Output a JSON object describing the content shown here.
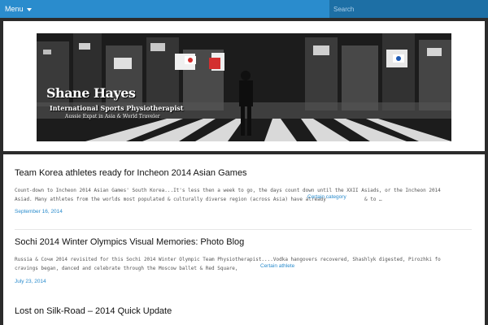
{
  "topbar": {
    "menu_label": "Menu",
    "search_placeholder": "Search",
    "colors": {
      "bar": "#2a8ccd",
      "search_bg": "#1d6fa5"
    }
  },
  "header": {
    "title": "Shane Hayes",
    "subtitle": "International Sports Physiotherapist",
    "tagline": "Aussie Expat in Asia & World Traveler"
  },
  "posts": [
    {
      "title": "Team Korea athletes ready for Incheon 2014 Asian Games",
      "excerpt_line1": "Count-down to Incheon 2014 Asian Games' South Korea...It's less then a week to go, the days count down until the XXII Asiads, or the Incheon 2014",
      "excerpt_line2": "Asiad. Many athletes from the worlds most populated & culturally diverse region (across Asia) have already",
      "excerpt_tail": "& to …",
      "category": "Certain category",
      "date": "September 16, 2014"
    },
    {
      "title": "Sochi 2014 Winter Olympics Visual Memories: Photo Blog",
      "excerpt_line1": "Russia & Сочи 2014 revisited for this Sochi 2014 Winter Olympic Team Physiotherapist....Vodka hangovers recovered, Shashlyk digested, Pirozhki fo",
      "excerpt_line2": "cravings began, danced and celebrate through the Moscow ballet & Red Square,",
      "excerpt_tail": "",
      "category": "Certain athlete",
      "date": "July 23, 2014"
    },
    {
      "title": "Lost on Silk-Road – 2014 Quick Update"
    }
  ]
}
